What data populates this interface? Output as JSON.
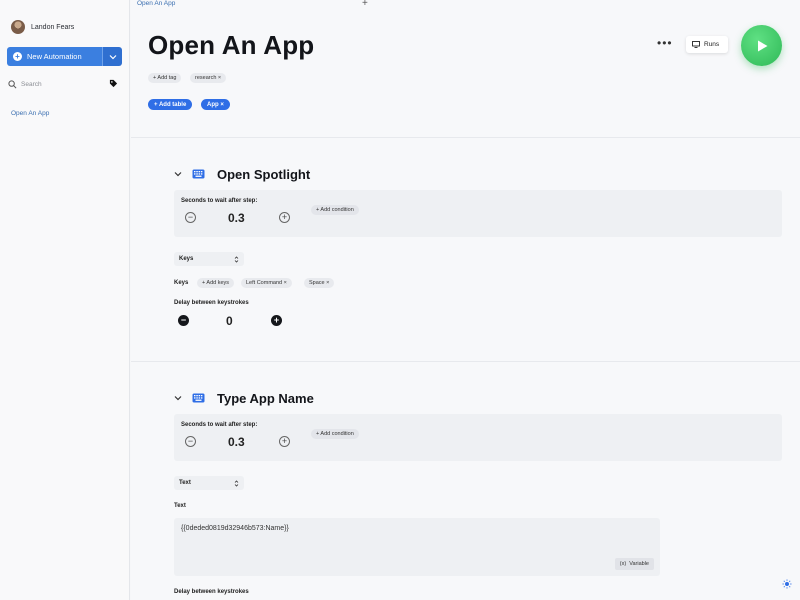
{
  "sidebar": {
    "user_name": "Landon Fears",
    "new_automation_label": "New Automation",
    "search_placeholder": "Search",
    "items": [
      {
        "label": "Open An App"
      }
    ]
  },
  "main": {
    "breadcrumb": "Open An App",
    "title": "Open An App",
    "runs_label": "Runs",
    "more_label": "•••",
    "add_tag_label": "+ Add tag",
    "tags": [
      "research ×"
    ],
    "add_table_label": "+ Add table",
    "tables": [
      "App ×"
    ]
  },
  "steps": [
    {
      "title": "Open Spotlight",
      "wait_label": "Seconds to wait after step:",
      "wait_value": "0.3",
      "add_condition_label": "+ Add condition",
      "action_type": "Keys",
      "keys_label": "Keys",
      "add_keys_label": "+ Add keys",
      "keys": [
        "Left Command ×",
        "Space ×"
      ],
      "delay_label": "Delay between keystrokes",
      "delay_value": "0"
    },
    {
      "title": "Type App Name",
      "wait_label": "Seconds to wait after step:",
      "wait_value": "0.3",
      "add_condition_label": "+ Add condition",
      "action_type": "Text",
      "text_label": "Text",
      "text_value": "{{0deded0819d32946b573:Name}}",
      "variable_label": "Variable",
      "delay_label": "Delay between keystrokes"
    }
  ],
  "colors": {
    "accent": "#2f6ee6",
    "play": "#2fb957"
  }
}
